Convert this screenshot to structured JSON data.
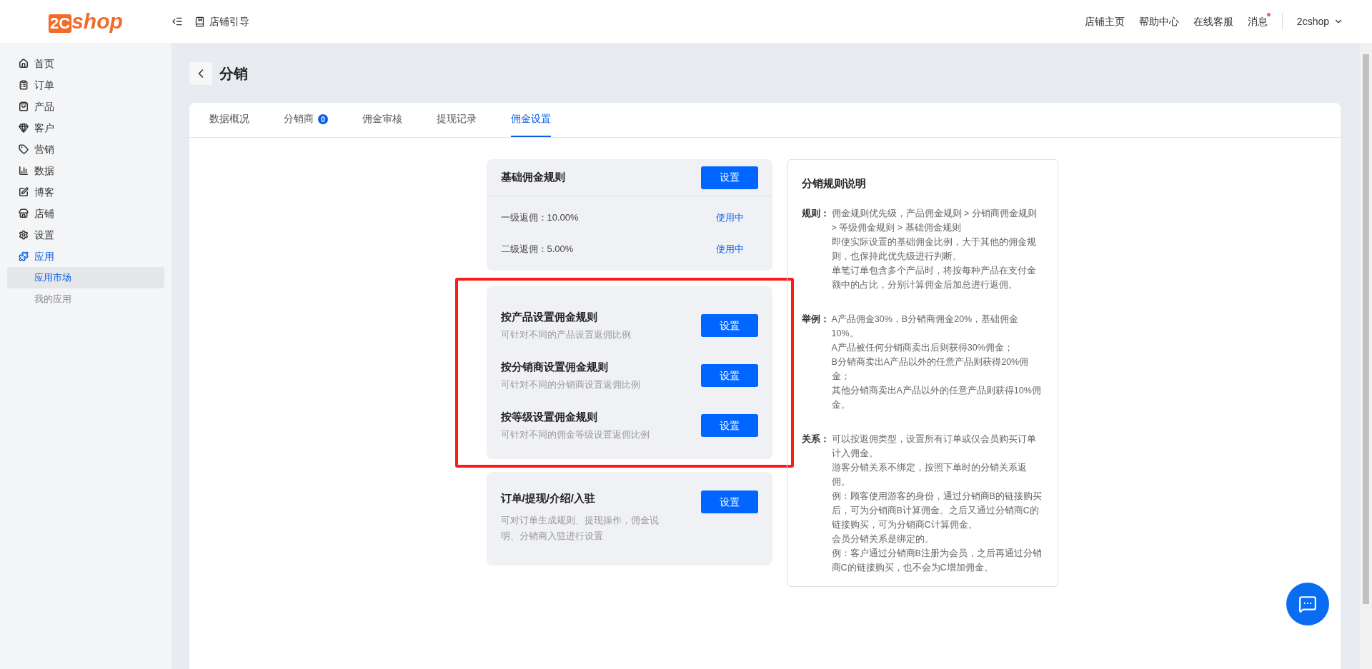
{
  "header": {
    "logo": {
      "prefix": "2C",
      "name": "shop"
    },
    "guide": "店铺引导",
    "links": [
      {
        "label": "店铺主页",
        "dot": false
      },
      {
        "label": "帮助中心",
        "dot": false
      },
      {
        "label": "在线客服",
        "dot": false
      },
      {
        "label": "消息",
        "dot": true
      }
    ],
    "user": "2cshop"
  },
  "sidebar": {
    "items": [
      {
        "label": "首页",
        "selected": false
      },
      {
        "label": "订单",
        "selected": false
      },
      {
        "label": "产品",
        "selected": false
      },
      {
        "label": "客户",
        "selected": false
      },
      {
        "label": "营销",
        "selected": false
      },
      {
        "label": "数据",
        "selected": false
      },
      {
        "label": "博客",
        "selected": false
      },
      {
        "label": "店铺",
        "selected": false
      },
      {
        "label": "设置",
        "selected": false
      },
      {
        "label": "应用",
        "selected": true,
        "children": [
          {
            "label": "应用市场",
            "selected": true
          },
          {
            "label": "我的应用",
            "selected": false
          }
        ]
      }
    ]
  },
  "page": {
    "title": "分销"
  },
  "tabs": [
    {
      "label": "数据概况",
      "selected": false
    },
    {
      "label": "分销商",
      "badge": "0",
      "selected": false
    },
    {
      "label": "佣金审核",
      "selected": false
    },
    {
      "label": "提现记录",
      "selected": false
    },
    {
      "label": "佣金设置",
      "selected": true
    }
  ],
  "basic_rule": {
    "title": "基础佣金规则",
    "button": "设置",
    "rows": [
      {
        "label": "一级返佣：10.00%",
        "status": "使用中"
      },
      {
        "label": "二级返佣：5.00%",
        "status": "使用中"
      }
    ]
  },
  "custom_rules": [
    {
      "title": "按产品设置佣金规则",
      "description": "可针对不同的产品设置返佣比例",
      "button": "设置"
    },
    {
      "title": "按分销商设置佣金规则",
      "description": "可针对不同的分销商设置返佣比例",
      "button": "设置"
    },
    {
      "title": "按等级设置佣金规则",
      "description": "可针对不同的佣金等级设置返佣比例",
      "button": "设置"
    }
  ],
  "other_settings": {
    "title": "订单/提现/介绍/入驻",
    "description": "可对订单生成规则、提现操作，佣金说明、分销商入驻进行设置",
    "button": "设置"
  },
  "explanation": {
    "title": "分销规则说明",
    "sections": [
      {
        "label": "规则：",
        "paragraphs": [
          "佣金规则优先级，产品佣金规则 > 分销商佣金规则 > 等级佣金规则 > 基础佣金规则",
          "即使实际设置的基础佣金比例，大于其他的佣金规则，也保持此优先级进行判断。",
          "单笔订单包含多个产品时，将按每种产品在支付金额中的占比，分别计算佣金后加总进行返佣。"
        ]
      },
      {
        "label": "举例：",
        "paragraphs": [
          "A产品佣金30%，B分销商佣金20%，基础佣金10%。",
          "A产品被任何分销商卖出后则获得30%佣金；",
          "B分销商卖出A产品以外的任意产品则获得20%佣金；",
          "其他分销商卖出A产品以外的任意产品则获得10%佣金。"
        ]
      },
      {
        "label": "关系：",
        "paragraphs": [
          "可以按返佣类型，设置所有订单或仅会员购买订单计入佣金。",
          "游客分销关系不绑定，按照下单时的分销关系返佣。",
          "例：顾客使用游客的身份，通过分销商B的链接购买后，可为分销商B计算佣金。之后又通过分销商C的链接购买，可为分销商C计算佣金。",
          "会员分销关系是绑定的。",
          "例：客户通过分销商B注册为会员，之后再通过分销商C的链接购买，也不会为C增加佣金。"
        ]
      }
    ]
  }
}
